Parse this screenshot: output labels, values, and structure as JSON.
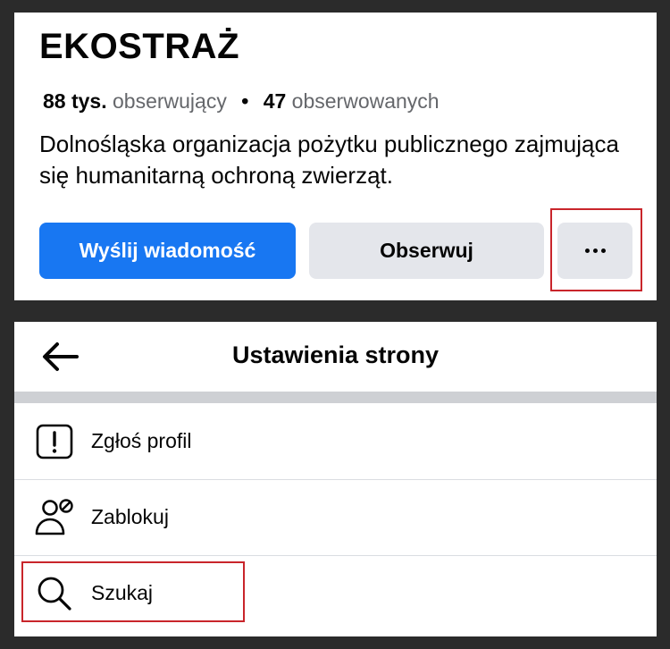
{
  "profile": {
    "name": "EKOSTRAŻ",
    "followers_count": "88 tys.",
    "followers_label": "obserwujący",
    "separator": "•",
    "following_count": "47",
    "following_label": "obserwowanych",
    "bio": "Dolnośląska organizacja pożytku publicznego zajmująca się humanitarną ochroną zwierząt.",
    "actions": {
      "message_label": "Wyślij wiadomość",
      "follow_label": "Obserwuj",
      "more_icon": "more-dots-icon"
    }
  },
  "settings": {
    "title": "Ustawienia strony",
    "back_icon": "back-arrow-icon",
    "items": [
      {
        "label": "Zgłoś profil",
        "icon": "report-icon"
      },
      {
        "label": "Zablokuj",
        "icon": "block-user-icon"
      },
      {
        "label": "Szukaj",
        "icon": "search-icon"
      }
    ]
  },
  "colors": {
    "primary": "#1877f2",
    "secondary_button": "#e4e6eb",
    "highlight": "#c9252b",
    "background": "#2b2b2b"
  }
}
